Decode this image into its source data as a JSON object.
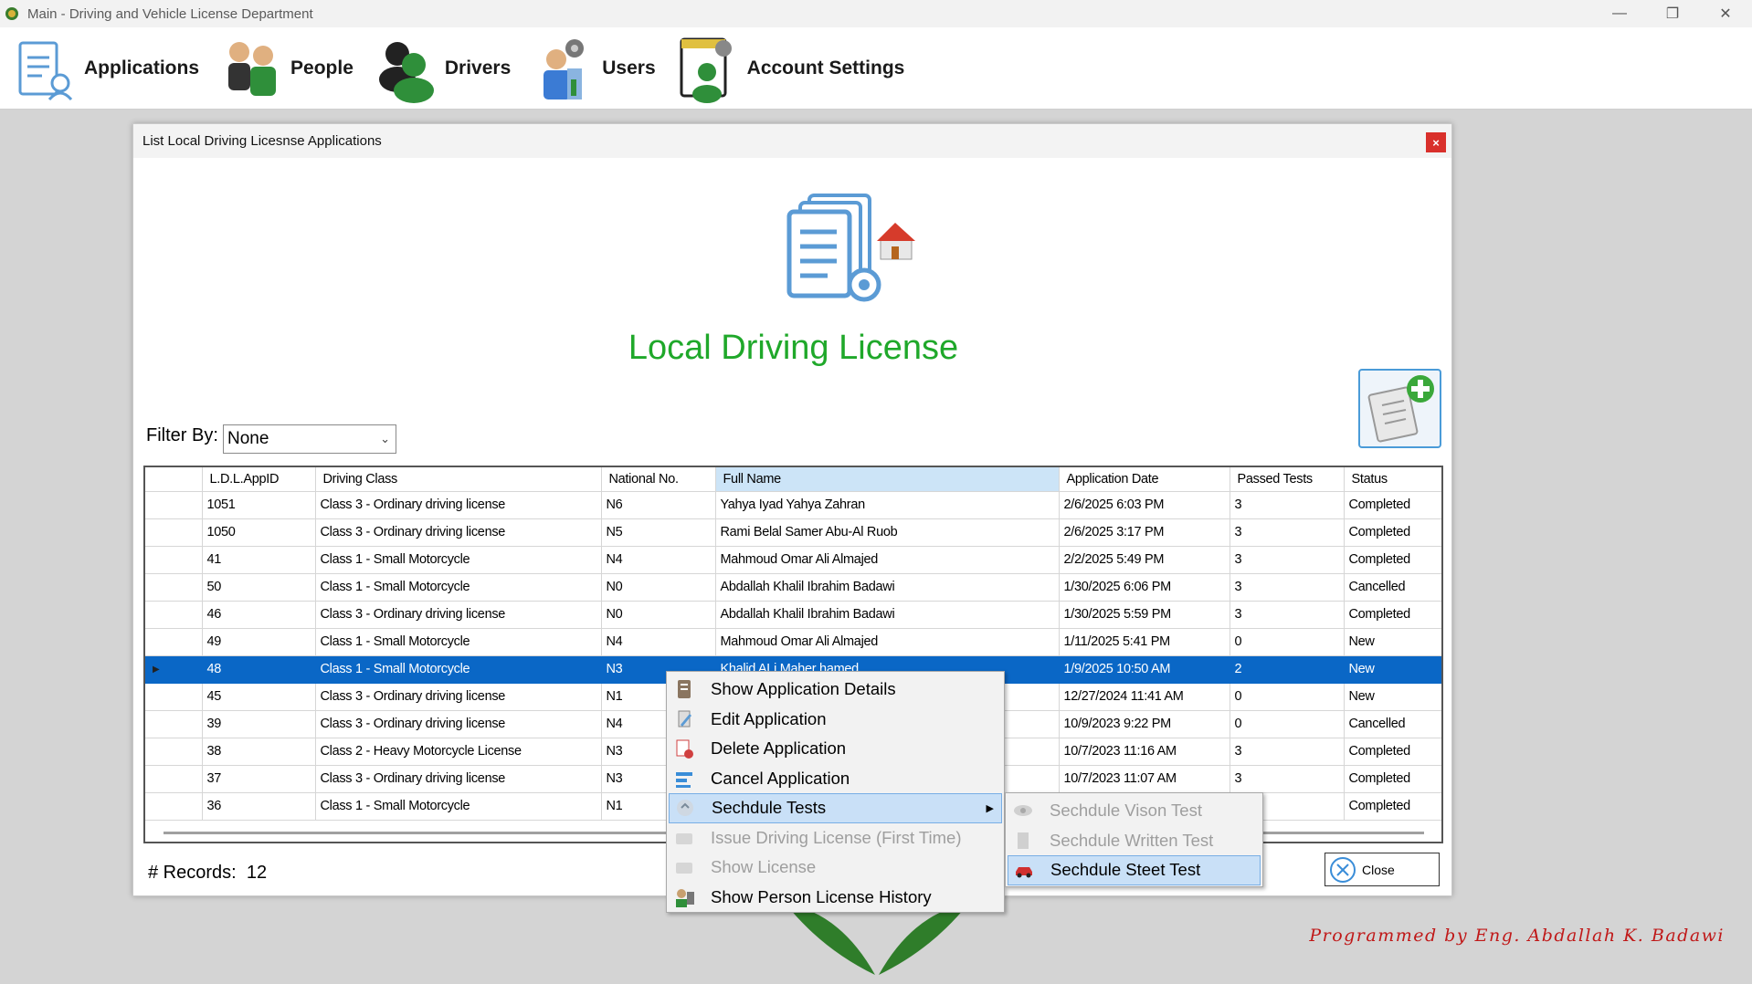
{
  "window": {
    "title": "Main - Driving and Vehicle License Department",
    "minimize_glyph": "—",
    "restore_glyph": "❐",
    "close_glyph": "✕"
  },
  "menu": {
    "items": [
      {
        "label": "Applications",
        "icon": "applications-icon"
      },
      {
        "label": "People",
        "icon": "people-icon"
      },
      {
        "label": "Drivers",
        "icon": "drivers-icon"
      },
      {
        "label": "Users",
        "icon": "users-icon"
      },
      {
        "label": "Account Settings",
        "icon": "account-settings-icon"
      }
    ]
  },
  "child": {
    "title": "List Local Driving Licesnse Applications",
    "close_glyph": "×",
    "heading": "Local Driving License",
    "filter_label": "Filter By:",
    "filter_value": "None",
    "records_label": "# Records:",
    "records_count": "12",
    "close_button": "Close"
  },
  "grid": {
    "columns": [
      "L.D.L.AppID",
      "Driving Class",
      "National No.",
      "Full Name",
      "Application Date",
      "Passed Tests",
      "Status"
    ],
    "selected_column": "Full Name",
    "selected_row_index": 6,
    "rows": [
      [
        "1051",
        "Class 3 - Ordinary driving license",
        "N6",
        "Yahya Iyad Yahya Zahran",
        "2/6/2025 6:03 PM",
        "3",
        "Completed"
      ],
      [
        "1050",
        "Class 3 - Ordinary driving license",
        "N5",
        "Rami Belal Samer Abu-Al Ruob",
        "2/6/2025 3:17 PM",
        "3",
        "Completed"
      ],
      [
        "41",
        "Class 1 - Small Motorcycle",
        "N4",
        "Mahmoud Omar Ali Almajed",
        "2/2/2025 5:49 PM",
        "3",
        "Completed"
      ],
      [
        "50",
        "Class 1 - Small Motorcycle",
        "N0",
        "Abdallah Khalil Ibrahim Badawi",
        "1/30/2025 6:06 PM",
        "3",
        "Cancelled"
      ],
      [
        "46",
        "Class 3 - Ordinary driving license",
        "N0",
        "Abdallah Khalil Ibrahim Badawi",
        "1/30/2025 5:59 PM",
        "3",
        "Completed"
      ],
      [
        "49",
        "Class 1 - Small Motorcycle",
        "N4",
        "Mahmoud Omar Ali Almajed",
        "1/11/2025 5:41 PM",
        "0",
        "New"
      ],
      [
        "48",
        "Class 1 - Small Motorcycle",
        "N3",
        "Khalid ALi Maher hamed",
        "1/9/2025 10:50 AM",
        "2",
        "New"
      ],
      [
        "45",
        "Class 3 - Ordinary driving license",
        "N1",
        "",
        "12/27/2024 11:41 AM",
        "0",
        "New"
      ],
      [
        "39",
        "Class 3 - Ordinary driving license",
        "N4",
        "",
        "10/9/2023 9:22 PM",
        "0",
        "Cancelled"
      ],
      [
        "38",
        "Class 2 - Heavy Motorcycle License",
        "N3",
        "",
        "10/7/2023 11:16 AM",
        "3",
        "Completed"
      ],
      [
        "37",
        "Class 3 - Ordinary driving license",
        "N3",
        "",
        "10/7/2023 11:07 AM",
        "3",
        "Completed"
      ],
      [
        "36",
        "Class 1 - Small Motorcycle",
        "N1",
        "",
        "",
        "",
        "Completed"
      ]
    ],
    "row_marker": "▶"
  },
  "context_menu": {
    "items": [
      {
        "label": "Show Application Details",
        "icon": "details-icon",
        "enabled": true
      },
      {
        "label": "Edit Application",
        "icon": "edit-icon",
        "enabled": true
      },
      {
        "label": "Delete Application",
        "icon": "delete-icon",
        "enabled": true
      },
      {
        "label": "Cancel Application",
        "icon": "cancel-icon",
        "enabled": true
      },
      {
        "label": "Sechdule Tests",
        "icon": "schedule-tests-icon",
        "enabled": true,
        "submenu": true,
        "hover": true
      },
      {
        "label": "Issue Driving License (First Time)",
        "icon": "issue-license-icon",
        "enabled": false
      },
      {
        "label": "Show License",
        "icon": "show-license-icon",
        "enabled": false
      },
      {
        "label": "Show Person License History",
        "icon": "license-history-icon",
        "enabled": true
      }
    ],
    "submenu_arrow": "▶"
  },
  "submenu": {
    "items": [
      {
        "label": "Sechdule Vison Test",
        "icon": "eye-icon",
        "enabled": false
      },
      {
        "label": "Sechdule Written Test",
        "icon": "written-test-icon",
        "enabled": false
      },
      {
        "label": "Sechdule Steet Test",
        "icon": "car-icon",
        "enabled": true,
        "hover": true
      }
    ]
  },
  "footer": {
    "credit": "Programmed by Eng. Abdallah K. Badawi"
  },
  "colors": {
    "accent_green": "#1fa82a",
    "selection_blue": "#0a67c6",
    "menu_hover": "#c9e0f7",
    "credit_red": "#c01818"
  }
}
